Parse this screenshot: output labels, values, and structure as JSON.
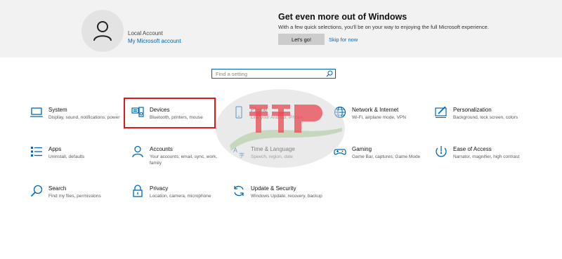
{
  "account": {
    "type": "Local Account",
    "link": "My Microsoft account"
  },
  "promo": {
    "title": "Get even more out of Windows",
    "description": "With a few quick selections, you'll be on your way to enjoying the full Microsoft experience.",
    "go_button": "Let's go!",
    "skip_link": "Skip for now"
  },
  "search": {
    "placeholder": "Find a setting",
    "icon": "search-icon"
  },
  "tiles": [
    {
      "title": "System",
      "desc": "Display, sound, notifications, power",
      "icon": "laptop-icon"
    },
    {
      "title": "Devices",
      "desc": "Bluetooth, printers, mouse",
      "icon": "keyboard-speaker-icon"
    },
    {
      "title": "Phone",
      "desc": "Link your Android, iPhone",
      "icon": "phone-icon"
    },
    {
      "title": "Network & Internet",
      "desc": "Wi-Fi, airplane mode, VPN",
      "icon": "globe-icon"
    },
    {
      "title": "Personalization",
      "desc": "Background, lock screen, colors",
      "icon": "paint-brush-icon"
    },
    {
      "title": "Apps",
      "desc": "Uninstall, defaults",
      "icon": "apps-list-icon"
    },
    {
      "title": "Accounts",
      "desc": "Your accounts, email, sync, work, family",
      "icon": "person-icon"
    },
    {
      "title": "Time & Language",
      "desc": "Speech, region, date",
      "icon": "time-language-icon"
    },
    {
      "title": "Gaming",
      "desc": "Game Bar, captures, Game Mode",
      "icon": "gamepad-icon"
    },
    {
      "title": "Ease of Access",
      "desc": "Narrator, magnifier, high contrast",
      "icon": "ease-of-access-icon"
    },
    {
      "title": "Search",
      "desc": "Find my files, permissions",
      "icon": "search-icon"
    },
    {
      "title": "Privacy",
      "desc": "Location, camera, microphone",
      "icon": "lock-icon"
    },
    {
      "title": "Update & Security",
      "desc": "Windows Update, recovery, backup",
      "icon": "sync-icon"
    }
  ],
  "colors": {
    "accent": "#0067b8",
    "banner_bg": "#f2f2f2",
    "highlight": "#e0151f"
  }
}
